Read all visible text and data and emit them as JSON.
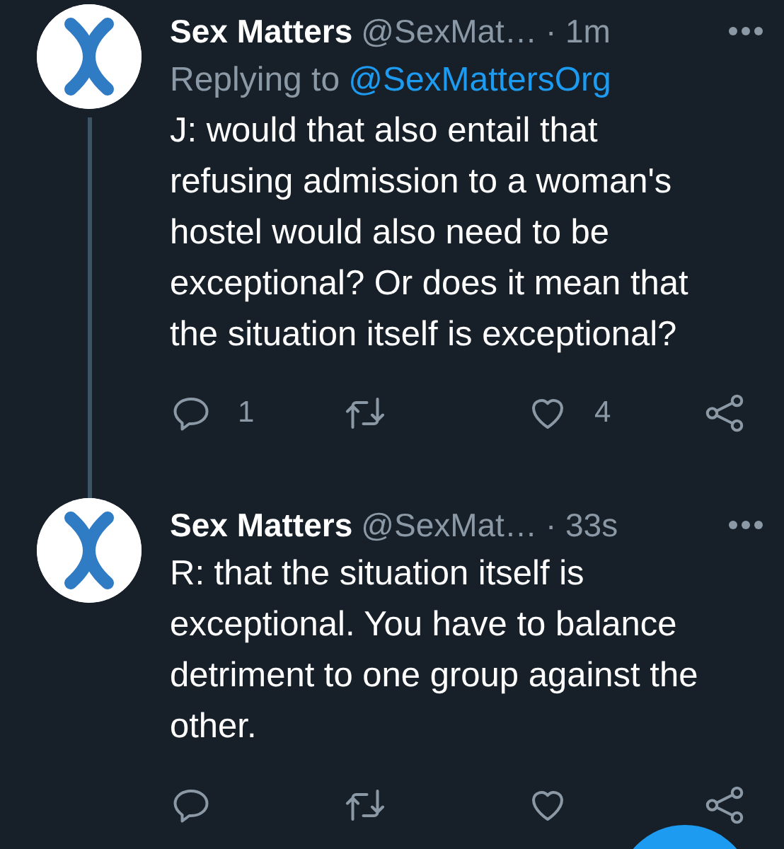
{
  "tweets": [
    {
      "name": "Sex Matters",
      "handle": "@SexMat…",
      "time": "· 1m",
      "thread_line": true,
      "replying_label": "Replying to",
      "replying_to": "@SexMattersOrg",
      "text_lines": [
        "J: would that also entail that",
        "refusing admission to a woman's",
        "hostel would also need to be",
        "exceptional? Or does it mean that",
        "the situation itself is exceptional?"
      ],
      "replies": "1",
      "likes": "4"
    },
    {
      "name": "Sex Matters",
      "handle": "@SexMat…",
      "time": "· 33s",
      "thread_line": false,
      "text_lines": [
        "R: that the situation itself is",
        "exceptional. You have to balance",
        "detriment to one group against the",
        "other."
      ]
    }
  ]
}
